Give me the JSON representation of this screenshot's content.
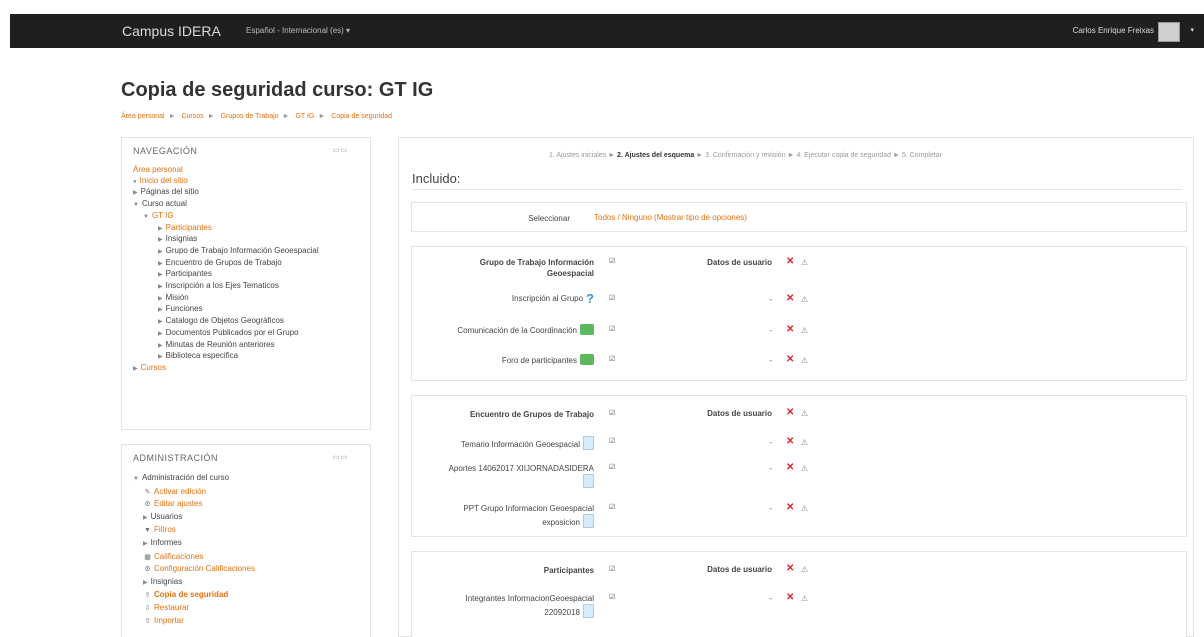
{
  "navbar": {
    "brand": "Campus IDERA",
    "language": "Español - Internacional (es) ▾",
    "user_name": "Carlos Enrique Freixas",
    "user_menu_caret": "▾"
  },
  "page": {
    "title": "Copia de seguridad curso: GT IG",
    "breadcrumb": [
      "Área personal",
      "Cursos",
      "Grupos de Trabajo",
      "GT IG",
      "Copia de seguridad"
    ]
  },
  "navigation": {
    "title": "NAVEGACIÓN",
    "controls": "▭▭",
    "items": [
      "Área personal",
      "Inicio del sitio",
      "Páginas del sitio",
      "Curso actual",
      "GT IG",
      "Participantes",
      "Insignias",
      "Grupo de Trabajo Información Geoespacial",
      "Encuentro de Grupos de Trabajo",
      "Participantes",
      "Inscripción a los Ejes Tematicos",
      "Misión",
      "Funciones",
      "Catalogo de Objetos Geográficos",
      "Documentos Publicados por el Grupo",
      "Minutas de Reunión anteriores",
      "Biblioteca especifica",
      "Cursos"
    ]
  },
  "administration": {
    "title": "ADMINISTRACIÓN",
    "controls": "▭▭",
    "items": [
      "Administración del curso",
      "Activar edición",
      "Editar ajustes",
      "Usuarios",
      "Filtros",
      "Informes",
      "Calificaciones",
      "Configuración Calificaciones",
      "Insignias",
      "Copia de seguridad",
      "Restaurar",
      "Importar"
    ]
  },
  "wizard": {
    "step1": "1. Ajustes iniciales",
    "step2": "2. Ajustes del esquema",
    "step3": "3. Confirmación y revisión",
    "step4": "4. Ejecutar copia de seguridad",
    "step5": "5. Completar",
    "arrow": "►"
  },
  "main": {
    "heading": "Incluido:",
    "select_label": "Seleccionar",
    "select_links": "Todos / Ninguno (Mostrar tipo de opciones)",
    "user_data_label": "Datos de usuario",
    "dash": "-",
    "x_mark": "✕",
    "warn_glyph": "⚠",
    "check_glyph": "☑"
  },
  "sections": [
    {
      "title_line1": "Grupo de Trabajo Información",
      "title_line2": "Geoespacial",
      "activities": [
        {
          "line1": "Inscripción al Grupo",
          "icon": "question-icon"
        },
        {
          "line1": "Comunicación de la Coordinación",
          "icon": "forum-icon"
        },
        {
          "line1": "Foro de participantes",
          "icon": "forum-icon"
        }
      ]
    },
    {
      "title_line1": "Encuentro de Grupos de Trabajo",
      "activities": [
        {
          "line1": "Temario Información Geoespacial",
          "icon": "file-icon"
        },
        {
          "line1": "Aportes 14062017 XIIJORNADASIDERA",
          "icon": "file-icon"
        },
        {
          "line1": "PPT Grupo Informacion Geoespacial",
          "line2": "exposicion",
          "icon": "file-icon"
        }
      ]
    },
    {
      "title_line1": "Participantes",
      "activities": [
        {
          "line1": "Integrantes InformacionGeoespacial",
          "line2": "22092018",
          "icon": "file-icon"
        }
      ]
    }
  ],
  "colors": {
    "accent": "#e8700d",
    "navbar": "#1f1f1f",
    "delete": "#d9262e"
  }
}
